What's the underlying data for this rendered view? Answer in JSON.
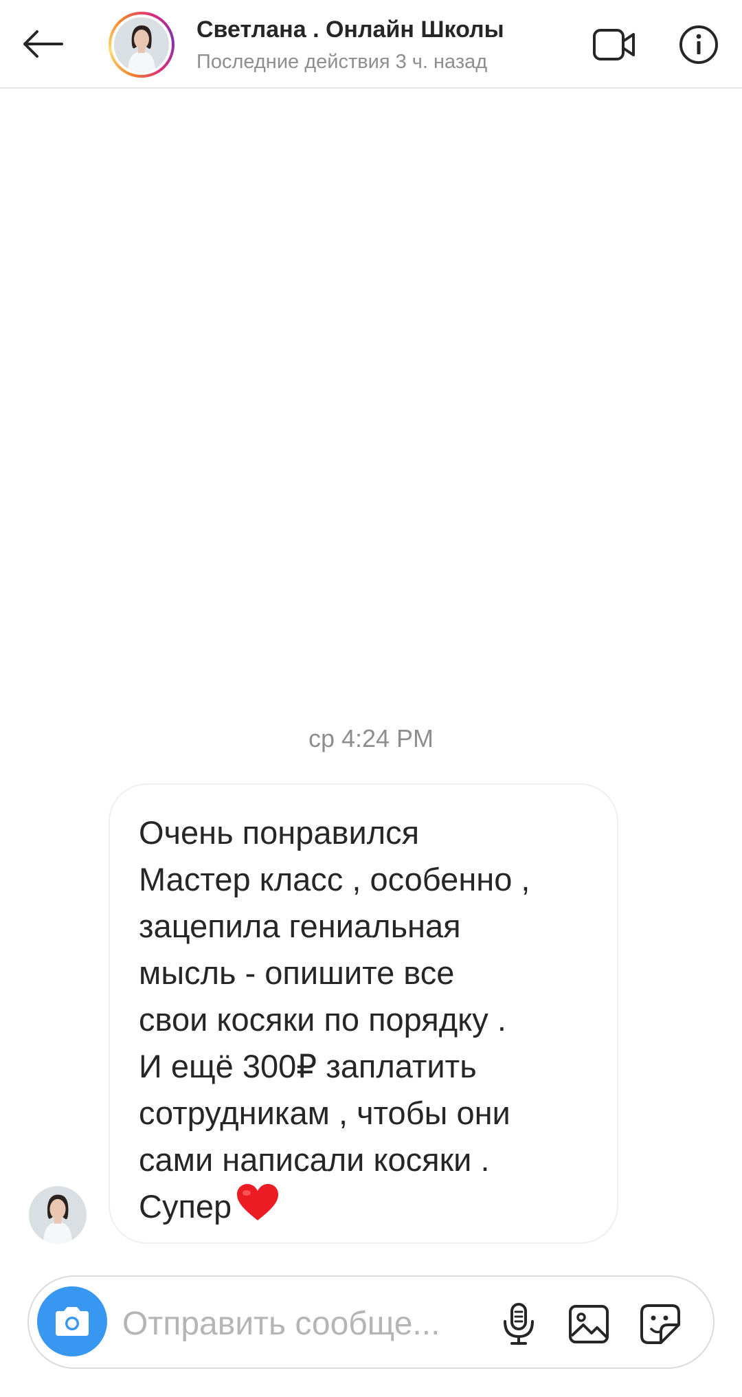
{
  "header": {
    "title": "Светлана . Онлайн Школы",
    "subtitle": "Последние действия 3 ч. назад",
    "back_icon": "arrow-left-icon",
    "video_icon": "video-camera-icon",
    "info_icon": "info-icon"
  },
  "chat": {
    "timestamp": "ср 4:24 PM",
    "messages": [
      {
        "sender": "Светлана . Онлайн Школы",
        "text": "Очень понравился\nМастер класс , особенно ,\nзацепила гениальная\nмысль - опишите все\nсвои косяки по порядку .\nИ ещё 300₽ заплатить\nсотрудникам , чтобы они\nсами написали косяки .\nСупер",
        "emoji": "heart-emoji"
      }
    ]
  },
  "composer": {
    "placeholder": "Отправить сообще...",
    "camera_icon": "camera-icon",
    "mic_icon": "microphone-icon",
    "gallery_icon": "gallery-icon",
    "sticker_icon": "sticker-icon"
  },
  "colors": {
    "accent": "#3897f0",
    "secondary_text": "#8e8e8e",
    "heart": "#ed1c24"
  }
}
